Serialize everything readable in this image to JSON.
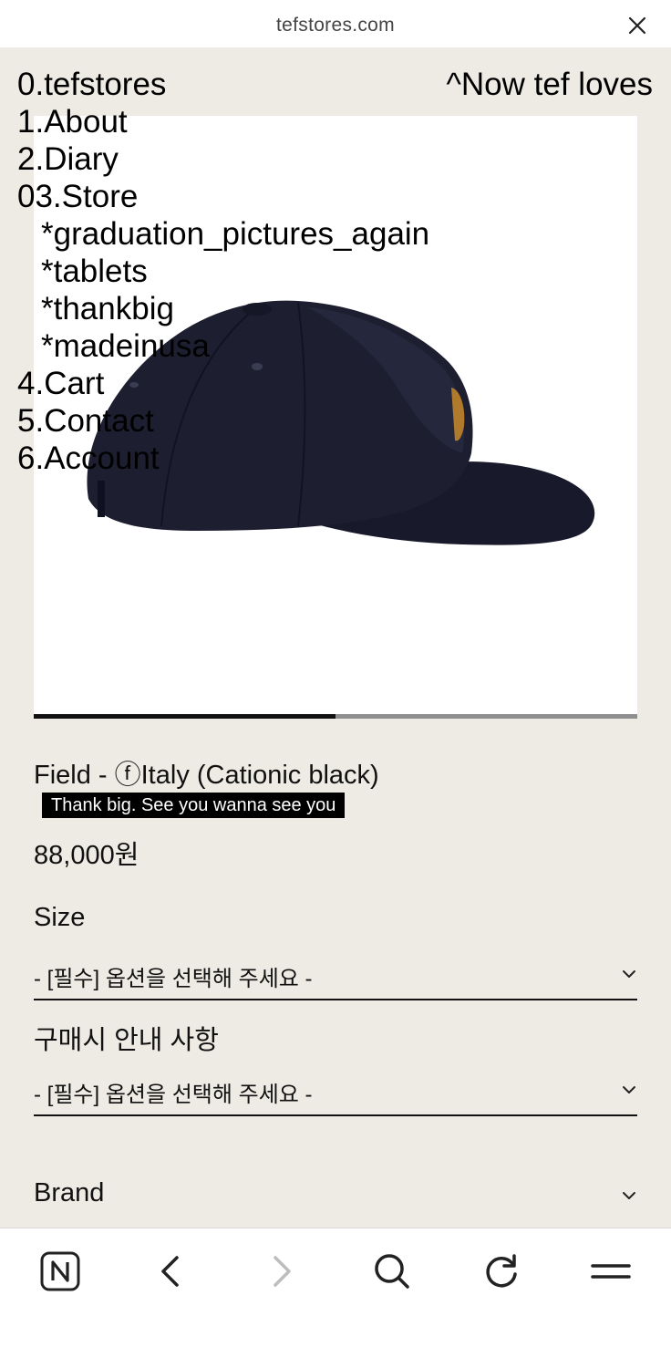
{
  "browser": {
    "url": "tefstores.com"
  },
  "menu": {
    "home": "0.tefstores",
    "about": "1.About",
    "diary": "2.Diary",
    "store": "03.Store",
    "sub_items": [
      "*graduation_pictures_again",
      "*tablets",
      "*thankbig",
      "*madeinusa"
    ],
    "cart": "4.Cart",
    "contact": "5.Contact",
    "account": "6.Account"
  },
  "header_right": "^Now tef loves",
  "image_slider": {
    "progress": 0.5
  },
  "product": {
    "title": "Field - ⓕItaly (Cationic black)",
    "tagline": "Thank big. See you wanna see you",
    "price": "88,000원"
  },
  "options": [
    {
      "label": "Size",
      "placeholder": "- [필수] 옵션을 선택해 주세요 -"
    },
    {
      "label": "구매시 안내 사항",
      "placeholder": "- [필수] 옵션을 선택해 주세요 -"
    }
  ],
  "brand_section": {
    "label": "Brand"
  },
  "toolbar": {
    "icons": [
      "naver-n-icon",
      "back-icon",
      "forward-icon",
      "search-icon",
      "refresh-icon",
      "menu-icon"
    ]
  },
  "colors": {
    "page_background": "#edebe3",
    "text": "#111111",
    "tagline_background": "#000000",
    "hat": "#1b1c2e"
  }
}
